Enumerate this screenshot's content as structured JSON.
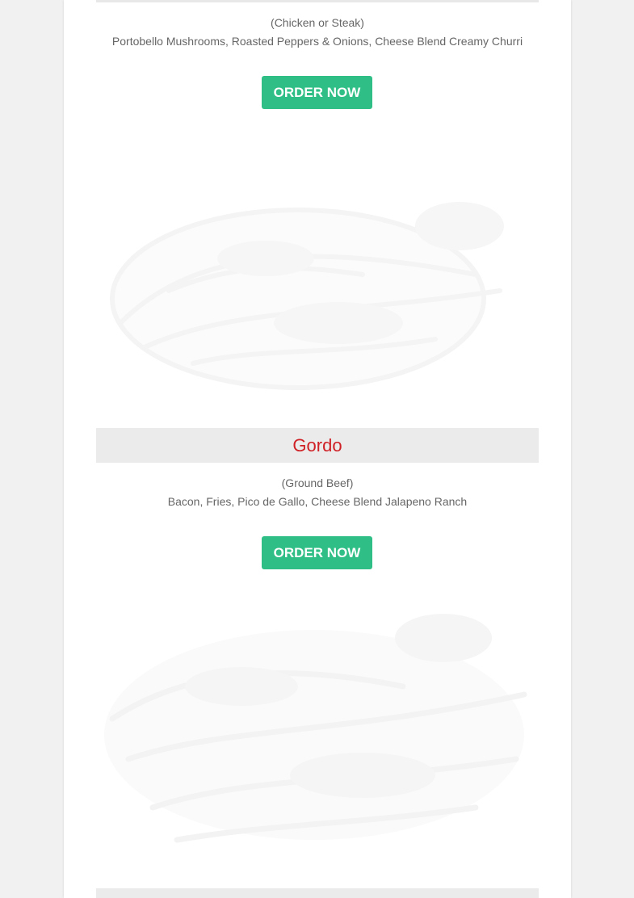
{
  "items": [
    {
      "title": "",
      "protein": "(Chicken or Steak)",
      "ingredients": "Portobello Mushrooms, Roasted Peppers & Onions, Cheese Blend Creamy Churri",
      "button_label": "ORDER NOW"
    },
    {
      "title": "Gordo",
      "protein": "(Ground Beef)",
      "ingredients": "Bacon, Fries, Pico de Gallo, Cheese Blend Jalapeno Ranch",
      "button_label": "ORDER NOW"
    }
  ],
  "colors": {
    "title": "#cf2026",
    "button": "#2fbf86",
    "title_bar": "#ebebeb",
    "text": "#666666"
  }
}
